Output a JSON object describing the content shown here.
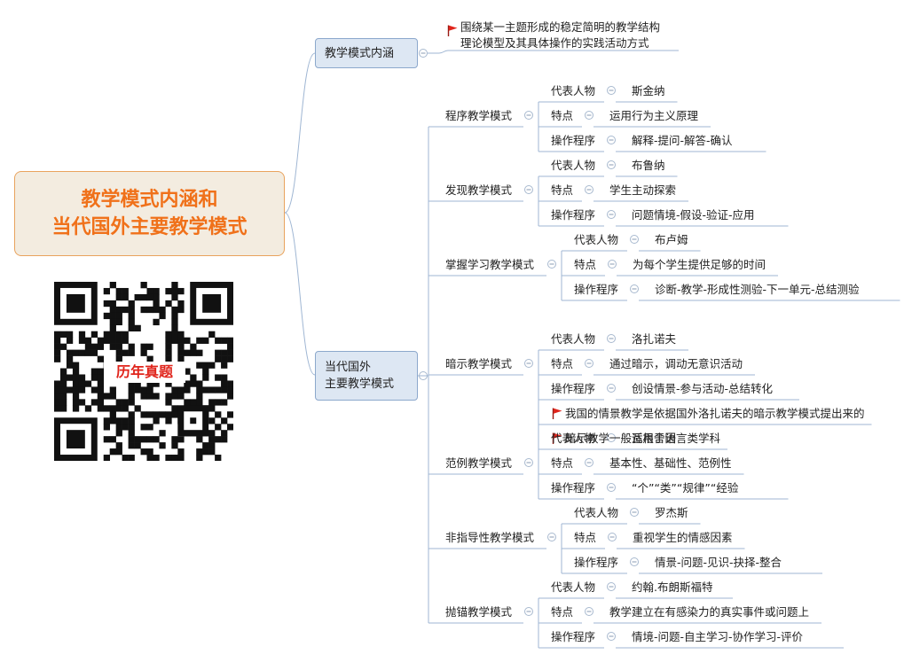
{
  "root": {
    "line1": "教学模式内涵和",
    "line2": "当代国外主要教学模式"
  },
  "branch_meaning": {
    "title": "教学模式内涵",
    "note_line1": "围绕某一主题形成的稳定简明的教学结构",
    "note_line2": "理论模型及其具体操作的实践活动方式"
  },
  "branch_models": {
    "line1": "当代国外",
    "line2": "主要教学模式"
  },
  "models": [
    {
      "name": "程序教学模式",
      "items": [
        {
          "key": "代表人物",
          "value": "斯金纳"
        },
        {
          "key": "特点",
          "value": "运用行为主义原理"
        },
        {
          "key": "操作程序",
          "value": "解释-提问-解答-确认"
        }
      ]
    },
    {
      "name": "发现教学模式",
      "items": [
        {
          "key": "代表人物",
          "value": "布鲁纳"
        },
        {
          "key": "特点",
          "value": "学生主动探索"
        },
        {
          "key": "操作程序",
          "value": "问题情境-假设-验证-应用"
        }
      ]
    },
    {
      "name": "掌握学习教学模式",
      "items": [
        {
          "key": "代表人物",
          "value": "布卢姆"
        },
        {
          "key": "特点",
          "value": "为每个学生提供足够的时间"
        },
        {
          "key": "操作程序",
          "value": "诊断-教学-形成性测验-下一单元-总结测验"
        }
      ]
    },
    {
      "name": "暗示教学模式",
      "items": [
        {
          "key": "代表人物",
          "value": "洛扎诺夫"
        },
        {
          "key": "特点",
          "value": "通过暗示，调动无意识活动"
        },
        {
          "key": "操作程序",
          "value": "创设情景-参与活动-总结转化"
        }
      ],
      "notes": [
        "我国的情景教学是依据国外洛扎诺夫的暗示教学模式提出来的",
        "暗示教学一般适用于语言类学科"
      ]
    },
    {
      "name": "范例教学模式",
      "items": [
        {
          "key": "代表人物",
          "value": "瓦根舍因"
        },
        {
          "key": "特点",
          "value": "基本性、基础性、范例性"
        },
        {
          "key": "操作程序",
          "value": "“个”“类”“规律”“经验"
        }
      ]
    },
    {
      "name": "非指导性教学模式",
      "items": [
        {
          "key": "代表人物",
          "value": "罗杰斯"
        },
        {
          "key": "特点",
          "value": "重视学生的情感因素"
        },
        {
          "key": "操作程序",
          "value": "情景-问题-见识-抉择-整合"
        }
      ]
    },
    {
      "name": "抛锚教学模式",
      "items": [
        {
          "key": "代表人物",
          "value": "约翰.布朗斯福特"
        },
        {
          "key": "特点",
          "value": "教学建立在有感染力的真实事件或问题上"
        },
        {
          "key": "操作程序",
          "value": "情境-问题-自主学习-协作学习-评价"
        }
      ]
    }
  ],
  "qr": {
    "label": "历年真题"
  },
  "colors": {
    "root_text": "#f0711a",
    "root_fill": "#f3ece0",
    "branch_fill": "#dde7f3",
    "line": "#9fb6d3",
    "flag": "#e0241b"
  },
  "icons": {
    "collapse": "minus-circle-icon",
    "note_marker": "red-flag-icon"
  }
}
